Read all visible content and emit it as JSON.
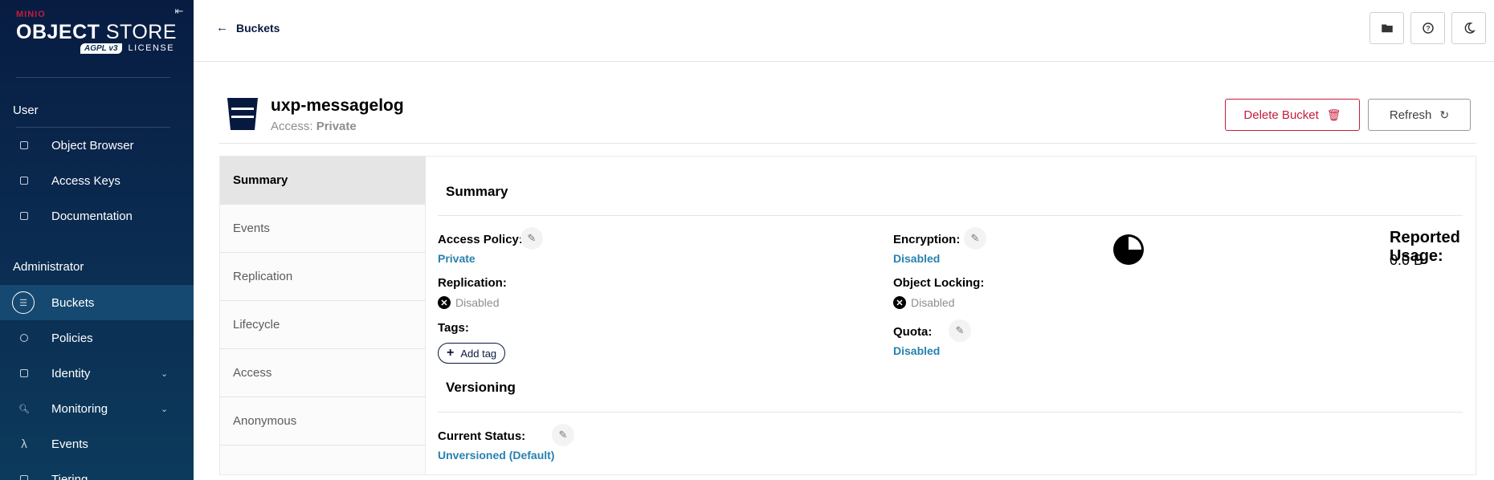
{
  "sidebar": {
    "brand": {
      "minio": "MINIO",
      "title_bold": "OBJECT",
      "title_rest": " STORE",
      "agpl": "AGPL v3",
      "license": "LICENSE"
    },
    "collapse_icon": "collapse-left-icon",
    "sections": {
      "user": "User",
      "administrator": "Administrator"
    },
    "user_items": [
      {
        "label": "Object Browser",
        "icon": "object-browser-icon"
      },
      {
        "label": "Access Keys",
        "icon": "access-keys-icon"
      },
      {
        "label": "Documentation",
        "icon": "documentation-icon"
      }
    ],
    "admin_items": [
      {
        "label": "Buckets",
        "icon": "buckets-icon",
        "active": true
      },
      {
        "label": "Policies",
        "icon": "policies-icon"
      },
      {
        "label": "Identity",
        "icon": "identity-icon",
        "expandable": true
      },
      {
        "label": "Monitoring",
        "icon": "monitoring-icon",
        "expandable": true
      },
      {
        "label": "Events",
        "icon": "lambda-icon"
      },
      {
        "label": "Tiering",
        "icon": "tiering-icon"
      }
    ]
  },
  "topbar": {
    "back_label": "Buckets",
    "buttons": [
      "folder-icon",
      "help-icon",
      "dark-mode-icon"
    ]
  },
  "bucket": {
    "name": "uxp-messagelog",
    "access_label": "Access:",
    "access_value": "Private"
  },
  "actions": {
    "delete_label": "Delete Bucket",
    "refresh_label": "Refresh"
  },
  "tabs": [
    "Summary",
    "Events",
    "Replication",
    "Lifecycle",
    "Access",
    "Anonymous"
  ],
  "active_tab": "Summary",
  "summary": {
    "title": "Summary",
    "access_policy_label": "Access Policy:",
    "access_policy_value": "Private",
    "replication_label": "Replication:",
    "replication_value": "Disabled",
    "tags_label": "Tags:",
    "add_tag_label": "Add tag",
    "encryption_label": "Encryption:",
    "encryption_value": "Disabled",
    "object_locking_label": "Object Locking:",
    "object_locking_value": "Disabled",
    "quota_label": "Quota:",
    "quota_value": "Disabled",
    "reported_usage_label": "Reported Usage:",
    "reported_usage_value": "0.0 B"
  },
  "versioning": {
    "title": "Versioning",
    "current_status_label": "Current Status:",
    "current_status_value": "Unversioned (Default)"
  },
  "colors": {
    "sidebar_bg": "#0b2d52",
    "active_item": "#154971",
    "brand_red": "#c51c3f",
    "link_blue": "#2781b0"
  }
}
